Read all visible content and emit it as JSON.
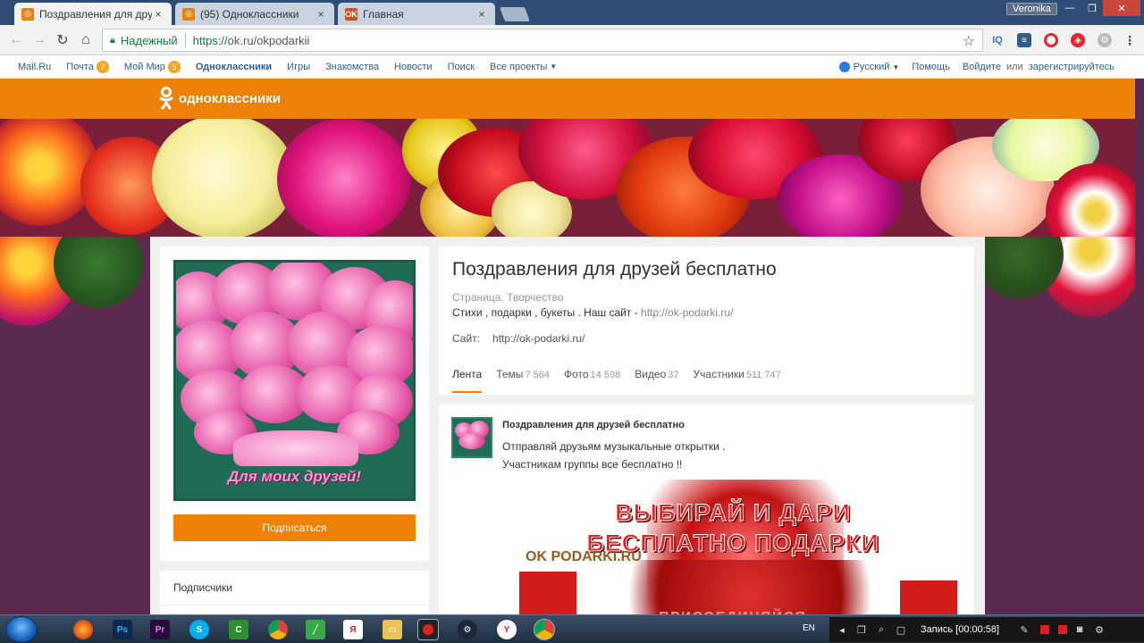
{
  "browser": {
    "tabs": [
      {
        "label": "Поздравления для друз",
        "close": "×",
        "favicon": "ok"
      },
      {
        "label": "(95) Одноклассники",
        "close": "×",
        "favicon": "ok"
      },
      {
        "label": "Главная",
        "close": "×",
        "favicon": "ok-red",
        "favicon_text": "OK"
      }
    ],
    "profile": "Veronika",
    "secure_label": "Надежный",
    "url_scheme": "https://",
    "url_rest": "ok.ru/okpodarkii",
    "extensions": [
      "IQ",
      "layers",
      "opera",
      "shield",
      "gear"
    ],
    "ext_iq": "IQ"
  },
  "mailbar": {
    "mailru": "Mail.Ru",
    "pochta": "Почта",
    "pochta_count": "7",
    "moymir": "Мой Мир",
    "moymir_count": "5",
    "ok": "Одноклассники",
    "igry": "Игры",
    "znakomstva": "Знакомства",
    "novosti": "Новости",
    "poisk": "Поиск",
    "vse": "Все проекты",
    "lang": "Русский",
    "help": "Помощь",
    "login": "Войдите",
    "or": "или",
    "register": "зарегистрируйтесь"
  },
  "ok": {
    "logo_text": "одноклассники"
  },
  "group": {
    "title": "Поздравления для друзей бесплатно",
    "type": "Страница, Творчество",
    "desc": "Стихи , подарки , букеты . Наш сайт - ",
    "desc_link": "http://ok-podarki.ru/",
    "site_label": "Сайт:",
    "site_link": "http://ok-podarki.ru/",
    "subscribe": "Подписаться",
    "avatar_caption": "Для моих друзей!",
    "subscribers": "Подписчики",
    "tabs": [
      {
        "label": "Лента",
        "count": ""
      },
      {
        "label": "Темы",
        "count": "7 564"
      },
      {
        "label": "Фото",
        "count": "14 598"
      },
      {
        "label": "Видео",
        "count": "37"
      },
      {
        "label": "Участники",
        "count": "511 747"
      }
    ]
  },
  "post": {
    "author": "Поздравления для друзей бесплатно",
    "line1": "Отправляй друзьям музыкальные открытки .",
    "line2": "Участникам группы все бесплатно !!",
    "img_line1": "ВЫБИРАЙ И ДАРИ",
    "img_line2": "БЕСПЛАТНО ПОДАРКИ",
    "img_logo": "OK PODARKI.RU",
    "img_sub": "ПРИСОЕДИНЯЙСЯ"
  },
  "taskbar": {
    "lang": "EN",
    "record": "Запись [00:00:58]",
    "apps": [
      "firefox",
      "photoshop",
      "premiere",
      "skype",
      "camtasia",
      "chrome",
      "green-app",
      "yandex",
      "explorer",
      "media",
      "steam",
      "yandex-browser",
      "chrome-active"
    ]
  },
  "colors": {
    "ok_orange": "#ee8208",
    "chrome_frame": "#2f4d74",
    "link_blue": "#2c5f99",
    "background_purple": "#5b2a4e"
  }
}
